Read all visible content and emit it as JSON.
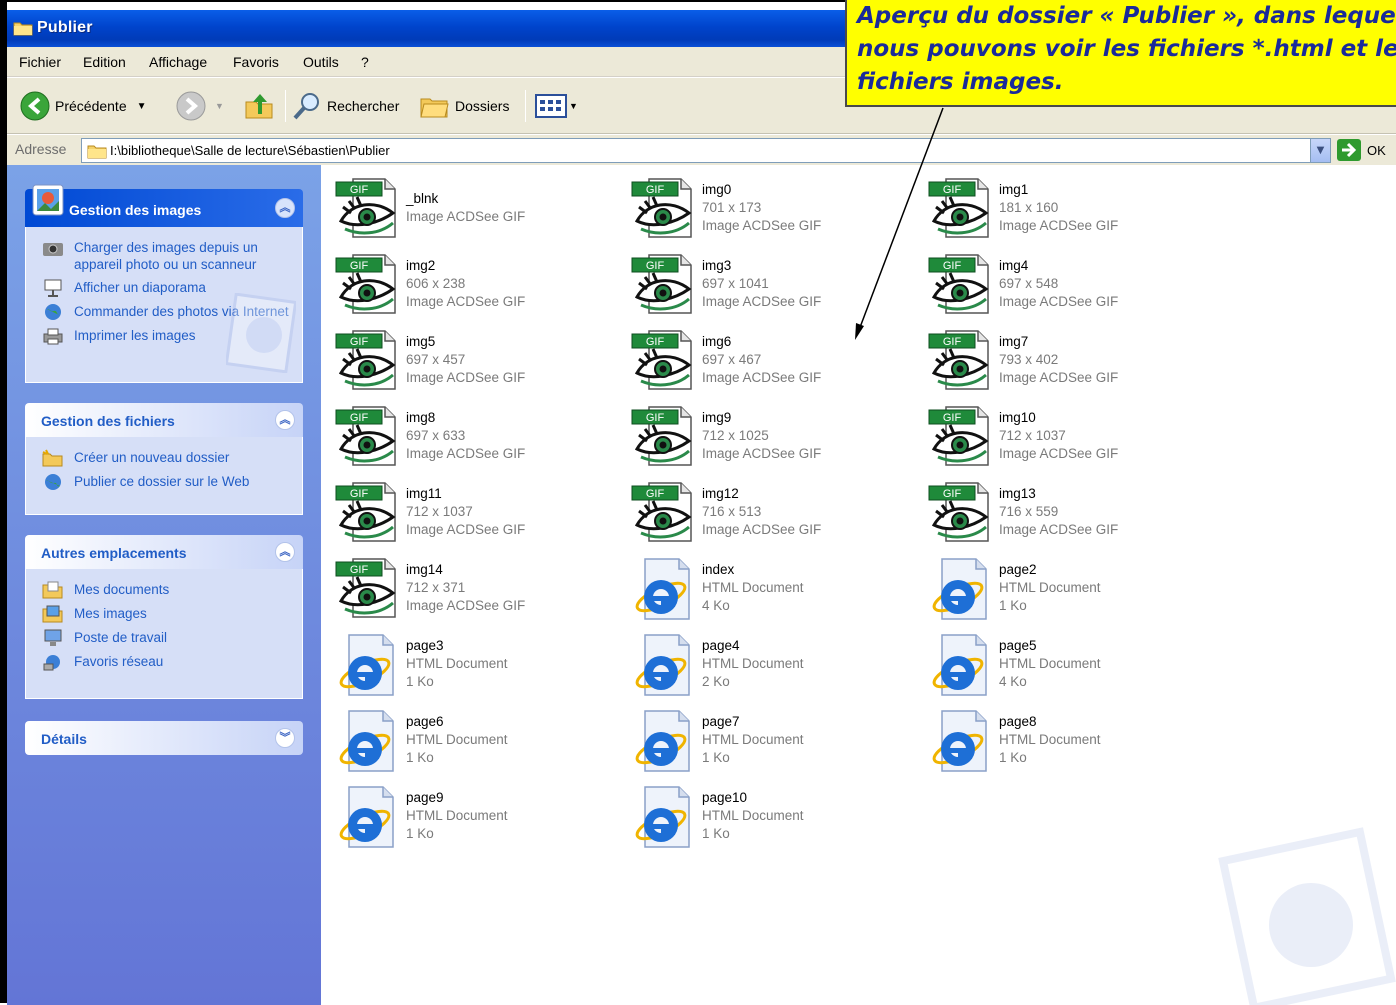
{
  "window": {
    "title": "Publier"
  },
  "menu": {
    "items": [
      "Fichier",
      "Edition",
      "Affichage",
      "Favoris",
      "Outils",
      "?"
    ]
  },
  "toolbar": {
    "back_label": "Précédente",
    "search_label": "Rechercher",
    "folders_label": "Dossiers"
  },
  "address": {
    "label": "Adresse",
    "path": "I:\\bibliotheque\\Salle de lecture\\Sébastien\\Publier",
    "go_label": "OK"
  },
  "sidebar": {
    "images_panel": {
      "title": "Gestion des images",
      "items": [
        "Charger des images depuis un appareil photo ou un scanneur",
        "Afficher un diaporama",
        "Commander des photos via Internet",
        "Imprimer les images"
      ]
    },
    "files_panel": {
      "title": "Gestion des fichiers",
      "items": [
        "Créer un nouveau dossier",
        "Publier ce dossier sur le Web"
      ]
    },
    "places_panel": {
      "title": "Autres emplacements",
      "items": [
        "Mes documents",
        "Mes images",
        "Poste de travail",
        "Favoris réseau"
      ]
    },
    "details_panel": {
      "title": "Détails"
    }
  },
  "files": [
    {
      "name": "_blnk",
      "line1": "Image ACDSee GIF",
      "line2": "",
      "type": "gif"
    },
    {
      "name": "img0",
      "line1": "701 x 173",
      "line2": "Image ACDSee GIF",
      "type": "gif"
    },
    {
      "name": "img1",
      "line1": "181 x 160",
      "line2": "Image ACDSee GIF",
      "type": "gif"
    },
    {
      "name": "img2",
      "line1": "606 x 238",
      "line2": "Image ACDSee GIF",
      "type": "gif"
    },
    {
      "name": "img3",
      "line1": "697 x 1041",
      "line2": "Image ACDSee GIF",
      "type": "gif"
    },
    {
      "name": "img4",
      "line1": "697 x 548",
      "line2": "Image ACDSee GIF",
      "type": "gif"
    },
    {
      "name": "img5",
      "line1": "697 x 457",
      "line2": "Image ACDSee GIF",
      "type": "gif"
    },
    {
      "name": "img6",
      "line1": "697 x 467",
      "line2": "Image ACDSee GIF",
      "type": "gif"
    },
    {
      "name": "img7",
      "line1": "793 x 402",
      "line2": "Image ACDSee GIF",
      "type": "gif"
    },
    {
      "name": "img8",
      "line1": "697 x 633",
      "line2": "Image ACDSee GIF",
      "type": "gif"
    },
    {
      "name": "img9",
      "line1": "712 x 1025",
      "line2": "Image ACDSee GIF",
      "type": "gif"
    },
    {
      "name": "img10",
      "line1": "712 x 1037",
      "line2": "Image ACDSee GIF",
      "type": "gif"
    },
    {
      "name": "img11",
      "line1": "712 x 1037",
      "line2": "Image ACDSee GIF",
      "type": "gif"
    },
    {
      "name": "img12",
      "line1": "716 x 513",
      "line2": "Image ACDSee GIF",
      "type": "gif"
    },
    {
      "name": "img13",
      "line1": "716 x 559",
      "line2": "Image ACDSee GIF",
      "type": "gif"
    },
    {
      "name": "img14",
      "line1": "712 x 371",
      "line2": "Image ACDSee GIF",
      "type": "gif"
    },
    {
      "name": "index",
      "line1": "HTML Document",
      "line2": "4 Ko",
      "type": "html"
    },
    {
      "name": "page2",
      "line1": "HTML Document",
      "line2": "1 Ko",
      "type": "html"
    },
    {
      "name": "page3",
      "line1": "HTML Document",
      "line2": "1 Ko",
      "type": "html"
    },
    {
      "name": "page4",
      "line1": "HTML Document",
      "line2": "2 Ko",
      "type": "html"
    },
    {
      "name": "page5",
      "line1": "HTML Document",
      "line2": "4 Ko",
      "type": "html"
    },
    {
      "name": "page6",
      "line1": "HTML Document",
      "line2": "1 Ko",
      "type": "html"
    },
    {
      "name": "page7",
      "line1": "HTML Document",
      "line2": "1 Ko",
      "type": "html"
    },
    {
      "name": "page8",
      "line1": "HTML Document",
      "line2": "1 Ko",
      "type": "html"
    },
    {
      "name": "page9",
      "line1": "HTML Document",
      "line2": "1 Ko",
      "type": "html"
    },
    {
      "name": "page10",
      "line1": "HTML Document",
      "line2": "1 Ko",
      "type": "html"
    }
  ],
  "gif_badge": "GIF",
  "callout": {
    "lines": [
      "Aperçu du dossier « Publier », dans lequel",
      "nous pouvons voir les fichiers *.html et les",
      "fichiers images."
    ]
  }
}
